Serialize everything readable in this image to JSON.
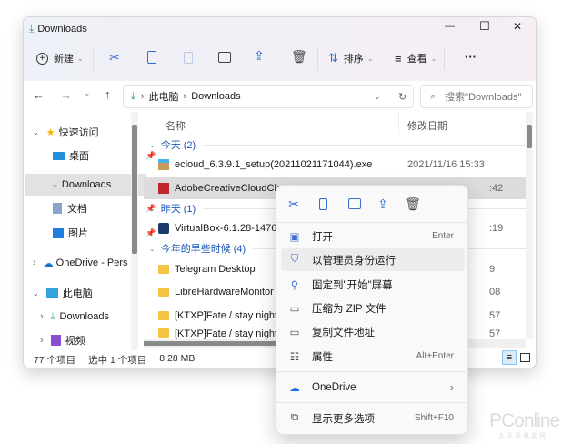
{
  "window": {
    "title": "Downloads",
    "minimize": "—",
    "maximize": "☐",
    "close": "✕"
  },
  "toolbar": {
    "new_label": "新建",
    "sort_label": "排序",
    "view_label": "查看",
    "more": "···"
  },
  "address": {
    "root": "此电脑",
    "current": "Downloads",
    "search_placeholder": "搜索\"Downloads\""
  },
  "sidebar": {
    "items": [
      {
        "label": "快速访问"
      },
      {
        "label": "桌面"
      },
      {
        "label": "Downloads"
      },
      {
        "label": "文档"
      },
      {
        "label": "图片"
      },
      {
        "label": "OneDrive - Pers"
      },
      {
        "label": "此电脑"
      },
      {
        "label": "Downloads"
      },
      {
        "label": "视频"
      }
    ]
  },
  "filelist": {
    "col_name": "名称",
    "col_date": "修改日期",
    "groups": [
      {
        "label": "今天 (2)"
      },
      {
        "label": "昨天 (1)"
      },
      {
        "label": "今年的早些时候 (4)"
      }
    ],
    "files": [
      {
        "name": "ecloud_6.3.9.1_setup(20211021171044).exe",
        "date": "2021/11/16 15:33"
      },
      {
        "name": "AdobeCreativeCloudClea",
        "date": ":42"
      },
      {
        "name": "VirtualBox-6.1.28-14762",
        "date": ":19"
      },
      {
        "name": "Telegram Desktop",
        "date": "9"
      },
      {
        "name": "LibreHardwareMonitor",
        "date": "08"
      },
      {
        "name": "[KTXP]Fate / stay night H",
        "date": "57"
      },
      {
        "name": "[KTXP]Fate / stay night H",
        "date": "57"
      }
    ]
  },
  "status": {
    "count": "77 个项目",
    "selected": "选中 1 个项目",
    "size": "8.28 MB"
  },
  "context_menu": {
    "items": [
      {
        "label": "打开",
        "shortcut": "Enter"
      },
      {
        "label": "以管理员身份运行",
        "shortcut": ""
      },
      {
        "label": "固定到\"开始\"屏幕",
        "shortcut": ""
      },
      {
        "label": "压缩为 ZIP 文件",
        "shortcut": ""
      },
      {
        "label": "复制文件地址",
        "shortcut": ""
      },
      {
        "label": "属性",
        "shortcut": "Alt+Enter"
      },
      {
        "label": "OneDrive",
        "shortcut": "›"
      },
      {
        "label": "显示更多选项",
        "shortcut": "Shift+F10"
      }
    ]
  },
  "watermark": {
    "text": "PConline",
    "sub": "太平洋电脑网"
  }
}
